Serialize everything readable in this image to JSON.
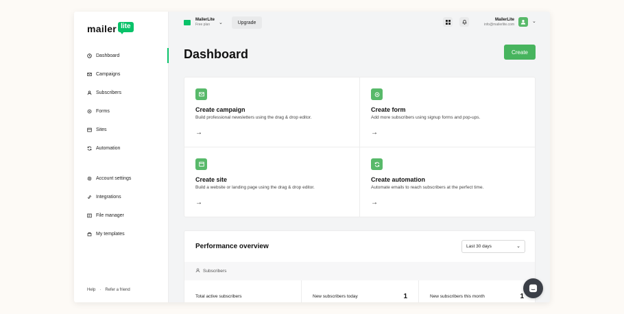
{
  "logo": {
    "text": "mailer",
    "badge": "lite"
  },
  "sidebar": {
    "items": [
      {
        "label": "Dashboard",
        "icon": "dashboard-icon"
      },
      {
        "label": "Campaigns",
        "icon": "envelope-icon"
      },
      {
        "label": "Subscribers",
        "icon": "user-icon"
      },
      {
        "label": "Forms",
        "icon": "forms-icon"
      },
      {
        "label": "Sites",
        "icon": "sites-icon"
      },
      {
        "label": "Automation",
        "icon": "refresh-icon"
      },
      {
        "label": "Account settings",
        "icon": "gear-icon"
      },
      {
        "label": "Integrations",
        "icon": "link-icon"
      },
      {
        "label": "File manager",
        "icon": "file-icon"
      },
      {
        "label": "My templates",
        "icon": "template-icon"
      }
    ],
    "footer": {
      "help": "Help",
      "sep": "·",
      "refer": "Refer a friend"
    }
  },
  "topbar": {
    "account_name": "MailerLite",
    "account_plan": "Free plan",
    "upgrade_label": "Upgrade",
    "user_name": "MailerLite",
    "user_email": "info@mailerlite.com"
  },
  "main": {
    "title": "Dashboard",
    "create_label": "Create",
    "cards": [
      {
        "title": "Create campaign",
        "desc": "Build professional newsletters using the drag & drop editor.",
        "icon": "envelope-icon"
      },
      {
        "title": "Create form",
        "desc": "Add more subscribers using signup forms and pop-ups.",
        "icon": "forms-icon"
      },
      {
        "title": "Create site",
        "desc": "Build a website or landing page using the drag & drop editor.",
        "icon": "sites-icon"
      },
      {
        "title": "Create automation",
        "desc": "Automate emails to reach subscribers at the perfect time.",
        "icon": "refresh-icon"
      }
    ],
    "performance": {
      "title": "Performance overview",
      "period": "Last 30 days",
      "section": "Subscribers",
      "stats": [
        {
          "label": "Total active subscribers",
          "value": ""
        },
        {
          "label": "New subscribers today",
          "value": "1"
        },
        {
          "label": "New subscribers this month",
          "value": "1"
        }
      ]
    }
  },
  "colors": {
    "accent": "#09c269",
    "button": "#47b45e",
    "icon_bg": "#58b96a"
  }
}
